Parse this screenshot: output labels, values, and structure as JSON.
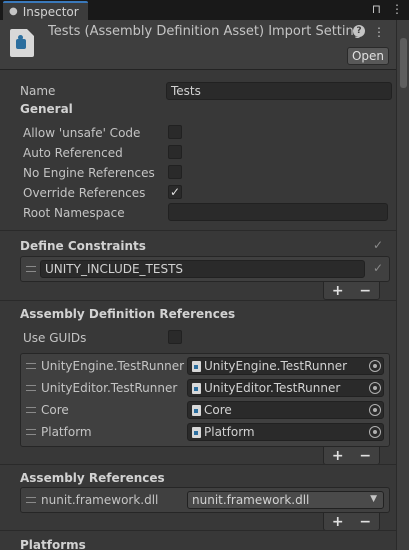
{
  "tab": {
    "label": "Inspector"
  },
  "header": {
    "title": "Tests (Assembly Definition Asset) Import Settings",
    "open_label": "Open"
  },
  "name_row": {
    "label": "Name",
    "value": "Tests"
  },
  "general": {
    "title": "General",
    "allow_unsafe": {
      "label": "Allow 'unsafe' Code",
      "checked": false
    },
    "auto_referenced": {
      "label": "Auto Referenced",
      "checked": false
    },
    "no_engine_references": {
      "label": "No Engine References",
      "checked": false
    },
    "override_references": {
      "label": "Override References",
      "checked": true
    },
    "root_namespace": {
      "label": "Root Namespace",
      "value": ""
    }
  },
  "define_constraints": {
    "title": "Define Constraints",
    "items": [
      {
        "value": "UNITY_INCLUDE_TESTS"
      }
    ]
  },
  "assembly_definition_references": {
    "title": "Assembly Definition References",
    "use_guids": {
      "label": "Use GUIDs",
      "checked": false
    },
    "items": [
      {
        "label": "UnityEngine.TestRunner",
        "value": "UnityEngine.TestRunner"
      },
      {
        "label": "UnityEditor.TestRunner",
        "value": "UnityEditor.TestRunner"
      },
      {
        "label": "Core",
        "value": "Core"
      },
      {
        "label": "Platform",
        "value": "Platform"
      }
    ]
  },
  "assembly_references": {
    "title": "Assembly References",
    "items": [
      {
        "label": "nunit.framework.dll",
        "value": "nunit.framework.dll"
      }
    ]
  },
  "platforms": {
    "title": "Platforms"
  },
  "list_controls": {
    "add": "+",
    "remove": "−"
  },
  "colors": {
    "accent": "#3a79bb",
    "background": "#383838",
    "field": "#2a2a2a"
  }
}
